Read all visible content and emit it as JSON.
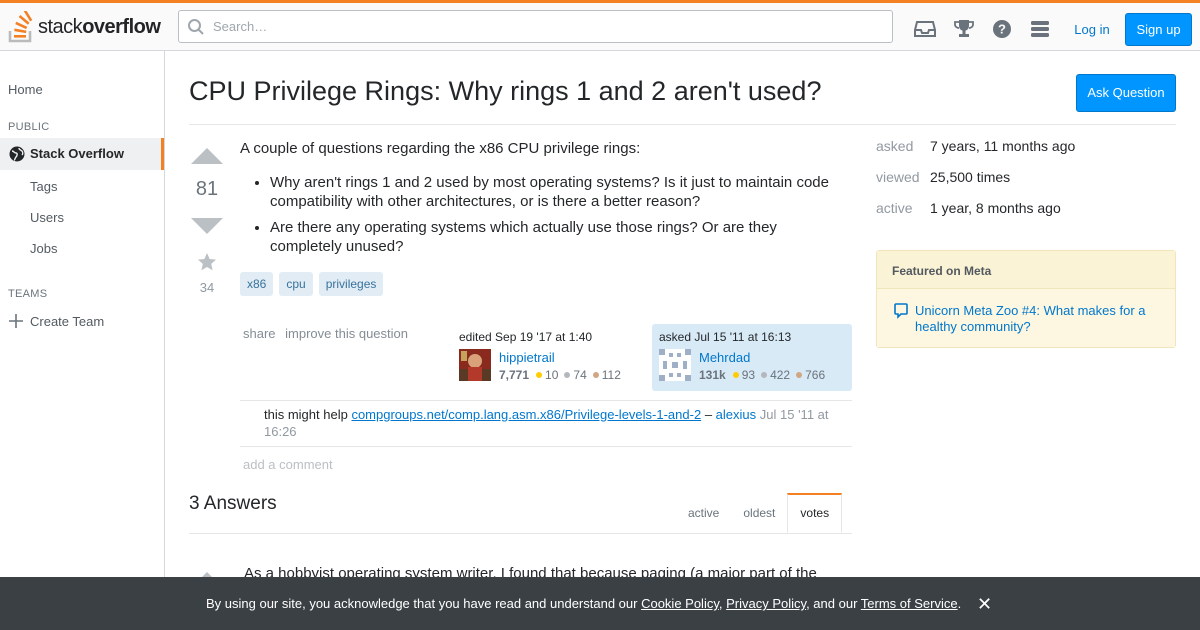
{
  "header": {
    "logo_text_light": "stack",
    "logo_text_bold": "overflow",
    "search_placeholder": "Search…",
    "icons": [
      "inbox-icon",
      "trophy-icon",
      "help-icon",
      "site-switcher-icon"
    ],
    "login_label": "Log in",
    "signup_label": "Sign up"
  },
  "sidebar": {
    "home": "Home",
    "public_heading": "PUBLIC",
    "stack_overflow": "Stack Overflow",
    "items": [
      "Tags",
      "Users",
      "Jobs"
    ],
    "teams_heading": "TEAMS",
    "create_team": "Create Team"
  },
  "question": {
    "title": "CPU Privilege Rings: Why rings 1 and 2 aren't used?",
    "ask_button": "Ask Question",
    "votes": "81",
    "favorites": "34",
    "intro": "A couple of questions regarding the x86 CPU privilege rings:",
    "bullets": [
      "Why aren't rings 1 and 2 used by most operating systems? Is it just to maintain code compatibility with other architectures, or is there a better reason?",
      "Are there any operating systems which actually use those rings? Or are they completely unused?"
    ],
    "tags": [
      "x86",
      "cpu",
      "privileges"
    ],
    "share_label": "share",
    "improve_label": "improve this question",
    "editor": {
      "action": "edited Sep 19 '17 at 1:40",
      "name": "hippietrail",
      "rep": "7,771",
      "gold": "10",
      "silver": "74",
      "bronze": "112"
    },
    "owner": {
      "action": "asked Jul 15 '11 at 16:13",
      "name": "Mehrdad",
      "rep": "131k",
      "gold": "93",
      "silver": "422",
      "bronze": "766"
    },
    "comment": {
      "text": "this might help",
      "link": "compgroups.net/comp.lang.asm.x86/Privilege-levels-1-and-2",
      "dash": "–",
      "user": "alexius",
      "date": "Jul 15 '11 at 16:26"
    },
    "add_comment": "add a comment"
  },
  "answers": {
    "heading": "3 Answers",
    "tabs": [
      "active",
      "oldest",
      "votes"
    ],
    "active_tab": "votes",
    "first_answer_preview": "As a hobbyist operating system writer, I found that because paging (a major part of the"
  },
  "stats": {
    "asked_label": "asked",
    "asked_value": "7 years, 11 months ago",
    "viewed_label": "viewed",
    "viewed_value": "25,500 times",
    "active_label": "active",
    "active_value": "1 year, 8 months ago"
  },
  "featured_meta": {
    "heading": "Featured on Meta",
    "link": "Unicorn Meta Zoo #4: What makes for a healthy community?"
  },
  "cookie_banner": {
    "prefix": "By using our site, you acknowledge that you have read and understand our",
    "cookie_policy": "Cookie Policy",
    "comma": ",",
    "privacy_policy": "Privacy Policy",
    "and_our": ", and our",
    "terms": "Terms of Service",
    "period": ".",
    "close": "✕"
  },
  "colors": {
    "accent": "#f48024",
    "primary_button": "#0095ff",
    "link": "#0077cc",
    "tag_bg": "#e1ecf4",
    "tag_text": "#39739d",
    "gold": "#ffcc01",
    "silver": "#b4b8bc",
    "bronze": "#d1a684"
  }
}
